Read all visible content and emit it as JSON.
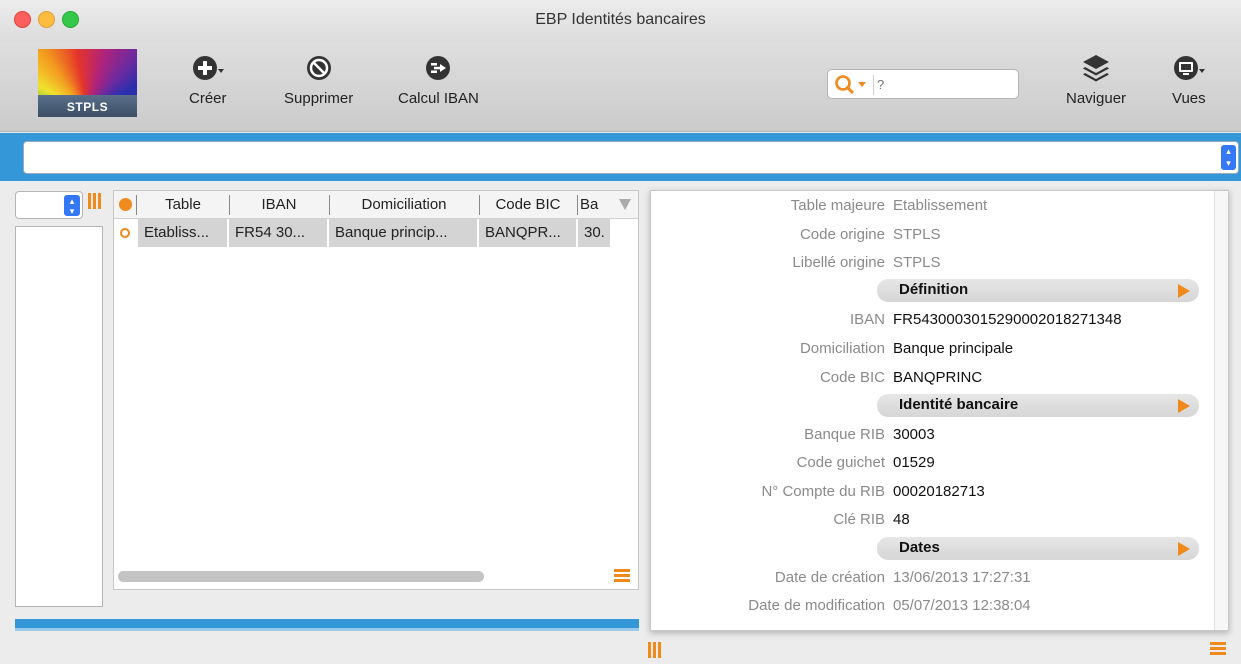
{
  "window": {
    "title": "EBP Identités bancaires"
  },
  "toolbar": {
    "logo_text": "STPLS",
    "create_label": "Créer",
    "delete_label": "Supprimer",
    "iban_label": "Calcul IBAN",
    "search_placeholder": "?",
    "navigate_label": "Naviguer",
    "views_label": "Vues"
  },
  "table": {
    "columns": [
      "Table",
      "IBAN",
      "Domiciliation",
      "Code BIC",
      "Ba"
    ],
    "rows": [
      {
        "cells": [
          "Etabliss...",
          "FR54 30...",
          "Banque princip...",
          "BANQPR...",
          "30."
        ]
      }
    ]
  },
  "detail": {
    "fields": [
      {
        "label": "Table majeure",
        "value": "Etablissement"
      },
      {
        "label": "Code origine",
        "value": "STPLS"
      },
      {
        "label": "Libellé origine",
        "value": "STPLS"
      }
    ],
    "section_definition": "Définition",
    "definition": [
      {
        "label": "IBAN",
        "value": "FR5430003015290002018271348"
      },
      {
        "label": "Domiciliation",
        "value": "Banque principale"
      },
      {
        "label": "Code BIC",
        "value": "BANQPRINC"
      }
    ],
    "section_identity": "Identité bancaire",
    "identity": [
      {
        "label": "Banque RIB",
        "value": "30003"
      },
      {
        "label": "Code guichet",
        "value": "01529"
      },
      {
        "label": "N° Compte du RIB",
        "value": "00020182713"
      },
      {
        "label": "Clé RIB",
        "value": "48"
      }
    ],
    "section_dates": "Dates",
    "dates": [
      {
        "label": "Date de création",
        "value": "13/06/2013 17:27:31"
      },
      {
        "label": "Date de modification",
        "value": "05/07/2013 12:38:04"
      }
    ]
  },
  "colors": {
    "accent_blue": "#3498d8",
    "accent_orange": "#f08a1c"
  }
}
